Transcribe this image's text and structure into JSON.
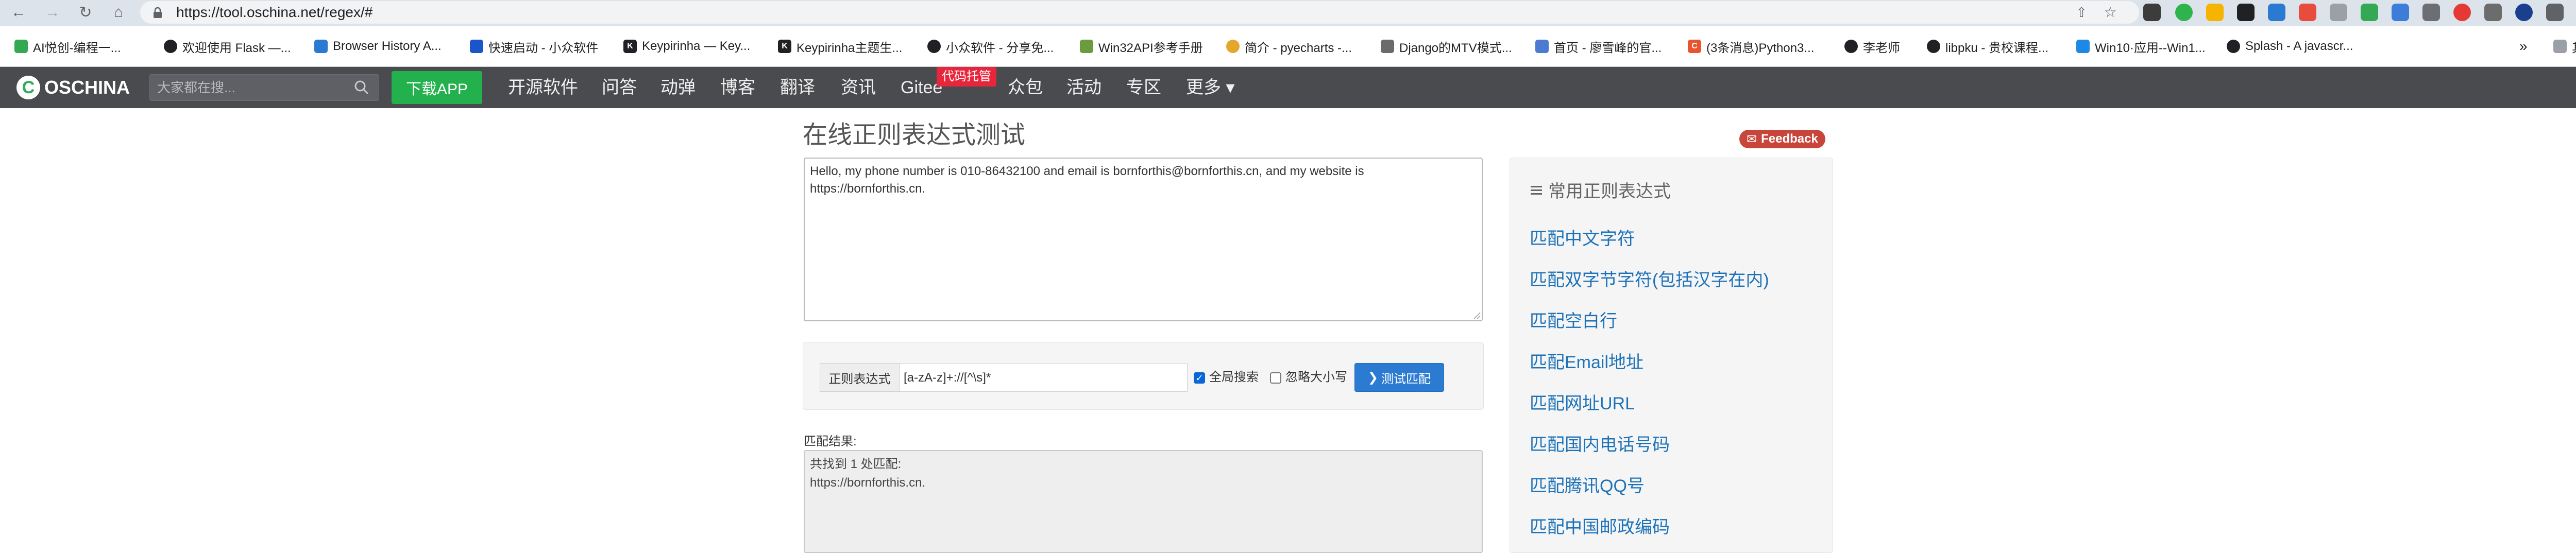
{
  "browser": {
    "url": "https://tool.oschina.net/regex/#"
  },
  "bookmarks": [
    {
      "label": "AI悦创-编程一...",
      "icon_color": "#34a853",
      "icon": "leaf-icon"
    },
    {
      "label": "欢迎使用 Flask —...",
      "icon_color": "#202124",
      "icon": "globe-icon"
    },
    {
      "label": "Browser History A...",
      "icon_color": "#2a7ad1",
      "icon": "grid-icon"
    },
    {
      "label": "快速启动 - 小众软件",
      "icon_color": "#1a56c9",
      "icon": "shield-icon"
    },
    {
      "label": "Keypirinha — Key...",
      "icon_color": "#202124",
      "icon": "k-icon"
    },
    {
      "label": "Keypirinha主题生...",
      "icon_color": "#202124",
      "icon": "k-icon"
    },
    {
      "label": "小众软件 - 分享免...",
      "icon_color": "#202124",
      "icon": "globe-icon"
    },
    {
      "label": "Win32API参考手册",
      "icon_color": "#6a9b3c",
      "icon": "book-icon"
    },
    {
      "label": "简介 - pyecharts -...",
      "icon_color": "#e2a72b",
      "icon": "smile-icon"
    },
    {
      "label": "Django的MTV模式...",
      "icon_color": "#6b6b6b",
      "icon": "leaf-icon"
    },
    {
      "label": "首页 - 廖雪峰的官...",
      "icon_color": "#4a7bd0",
      "icon": "plane-icon"
    },
    {
      "label": "(3条消息)Python3...",
      "icon_color": "#e8542f",
      "icon": "c-icon"
    },
    {
      "label": "李老师",
      "icon_color": "#202124",
      "icon": "github-icon"
    },
    {
      "label": "libpku - 贵校课程...",
      "icon_color": "#202124",
      "icon": "github-icon"
    },
    {
      "label": "Win10·应用--Win1...",
      "icon_color": "#1e88e5",
      "icon": "windows-icon"
    },
    {
      "label": "Splash - A javascr...",
      "icon_color": "#202124",
      "icon": "globe-icon"
    }
  ],
  "bookmarks_more": "»",
  "bookmarks_other": "其他书签",
  "site_nav": {
    "logo": "OSCHINA",
    "search_placeholder": "大家都在搜...",
    "download_app": "下载APP",
    "links": [
      "开源软件",
      "问答",
      "动弹",
      "博客",
      "翻译",
      "资讯",
      "Gitee",
      "众包",
      "活动",
      "专区",
      "更多 ▾"
    ],
    "gitee_badge": "代码托管"
  },
  "page": {
    "title": "在线正则表达式测试",
    "feedback": "Feedback",
    "source_text": "Hello, my phone number is 010-86432100 and email is bornforthis@bornforthis.cn, and my website is https://bornforthis.cn.",
    "regex_label": "正则表达式",
    "regex_value": "[a-zA-z]+://[^\\s]*",
    "global_label": "全局搜索",
    "global_checked": true,
    "ignore_case_label": "忽略大小写",
    "ignore_case_checked": false,
    "test_button": "测试匹配",
    "result_label": "匹配结果:",
    "result_lines": [
      "共找到 1 处匹配:",
      "https://bornforthis.cn."
    ]
  },
  "sidebar": {
    "title": "常用正则表达式",
    "items": [
      "匹配中文字符",
      "匹配双字节字符(包括汉字在内)",
      "匹配空白行",
      "匹配Email地址",
      "匹配网址URL",
      "匹配国内电话号码",
      "匹配腾讯QQ号",
      "匹配中国邮政编码"
    ]
  },
  "colors": {
    "nav_bg": "#4a4b4f",
    "brand_green": "#22b14c",
    "link_blue": "#1d72b8",
    "button_blue": "#2a7bd1",
    "feedback_red": "#c8453c"
  }
}
